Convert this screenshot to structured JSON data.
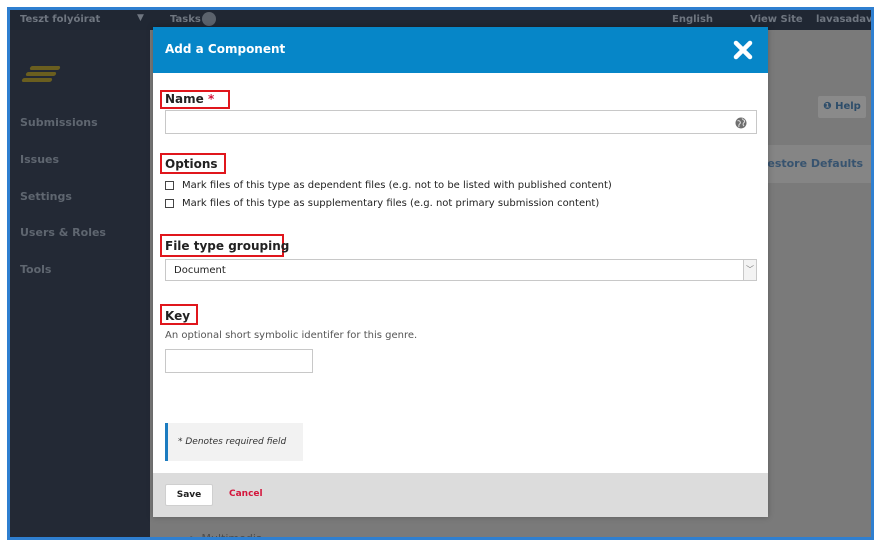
{
  "background_app": {
    "journal_name": "Teszt folyóirat",
    "caret": "▼",
    "tasks_label": "Tasks",
    "english_label": "English",
    "view_site_label": "View Site",
    "user_label": "lavasadavid",
    "sidebar_items": [
      "Submissions",
      "Issues",
      "Settings",
      "Users & Roles",
      "Tools"
    ],
    "help_label": "Help",
    "restore_defaults_label": "Restore Defaults",
    "list_item": "Multimedia"
  },
  "modal": {
    "title": "Add a Component",
    "name_label": "Name",
    "required_marker": "*",
    "options_label": "Options",
    "options": [
      "Mark files of this type as dependent files (e.g. not to be listed with published content)",
      "Mark files of this type as supplementary files (e.g. not primary submission content)"
    ],
    "file_type_grouping_label": "File type grouping",
    "file_type_grouping_value": "Document",
    "key_label": "Key",
    "key_description": "An optional short symbolic identifer for this genre.",
    "required_note": "* Denotes required field",
    "save_label": "Save",
    "cancel_label": "Cancel"
  },
  "colors": {
    "header_blue": "#0686c8",
    "highlight_red": "#e0161c",
    "required_red": "#d4163c"
  }
}
